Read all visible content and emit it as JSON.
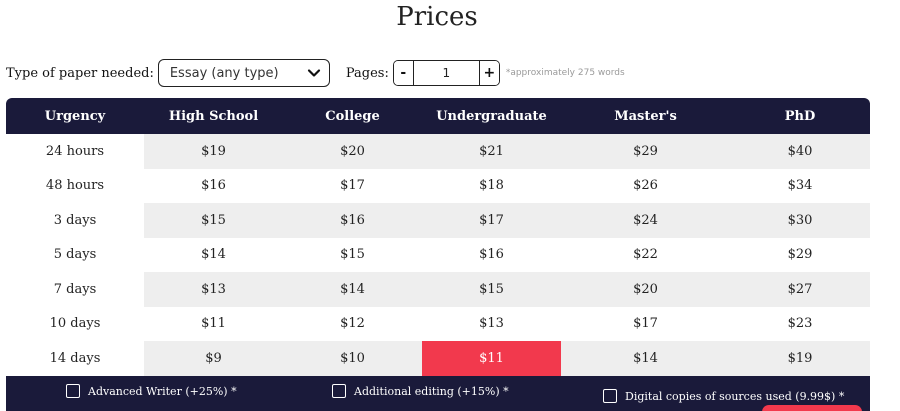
{
  "title": "Prices",
  "controls": {
    "paper_type_label": "Type of paper needed:",
    "paper_type_value": "Essay (any type)",
    "pages_label": "Pages:",
    "pages_minus": "-",
    "pages_value": "1",
    "pages_plus": "+",
    "pages_hint": "*approximately 275 words"
  },
  "table": {
    "headers": [
      "Urgency",
      "High School",
      "College",
      "Undergraduate",
      "Master's",
      "PhD"
    ],
    "rows": [
      [
        "24 hours",
        "$19",
        "$20",
        "$21",
        "$29",
        "$40"
      ],
      [
        "48 hours",
        "$16",
        "$17",
        "$18",
        "$26",
        "$34"
      ],
      [
        "3 days",
        "$15",
        "$16",
        "$17",
        "$24",
        "$30"
      ],
      [
        "5 days",
        "$14",
        "$15",
        "$16",
        "$22",
        "$29"
      ],
      [
        "7 days",
        "$13",
        "$14",
        "$15",
        "$20",
        "$27"
      ],
      [
        "10 days",
        "$11",
        "$12",
        "$13",
        "$17",
        "$23"
      ],
      [
        "14 days",
        "$9",
        "$10",
        "$11",
        "$14",
        "$19"
      ]
    ],
    "selected_cell": "14 days / Undergraduate"
  },
  "options": {
    "advanced_writer": "Advanced Writer (+25%) *",
    "additional_editing": "Additional editing (+15%) *",
    "digital_copies": "Digital copies of sources used (9.99$) *"
  },
  "colors": {
    "header_bg": "#1a1a3a",
    "accent": "#f2394d",
    "row_shade": "#eeeeee"
  }
}
